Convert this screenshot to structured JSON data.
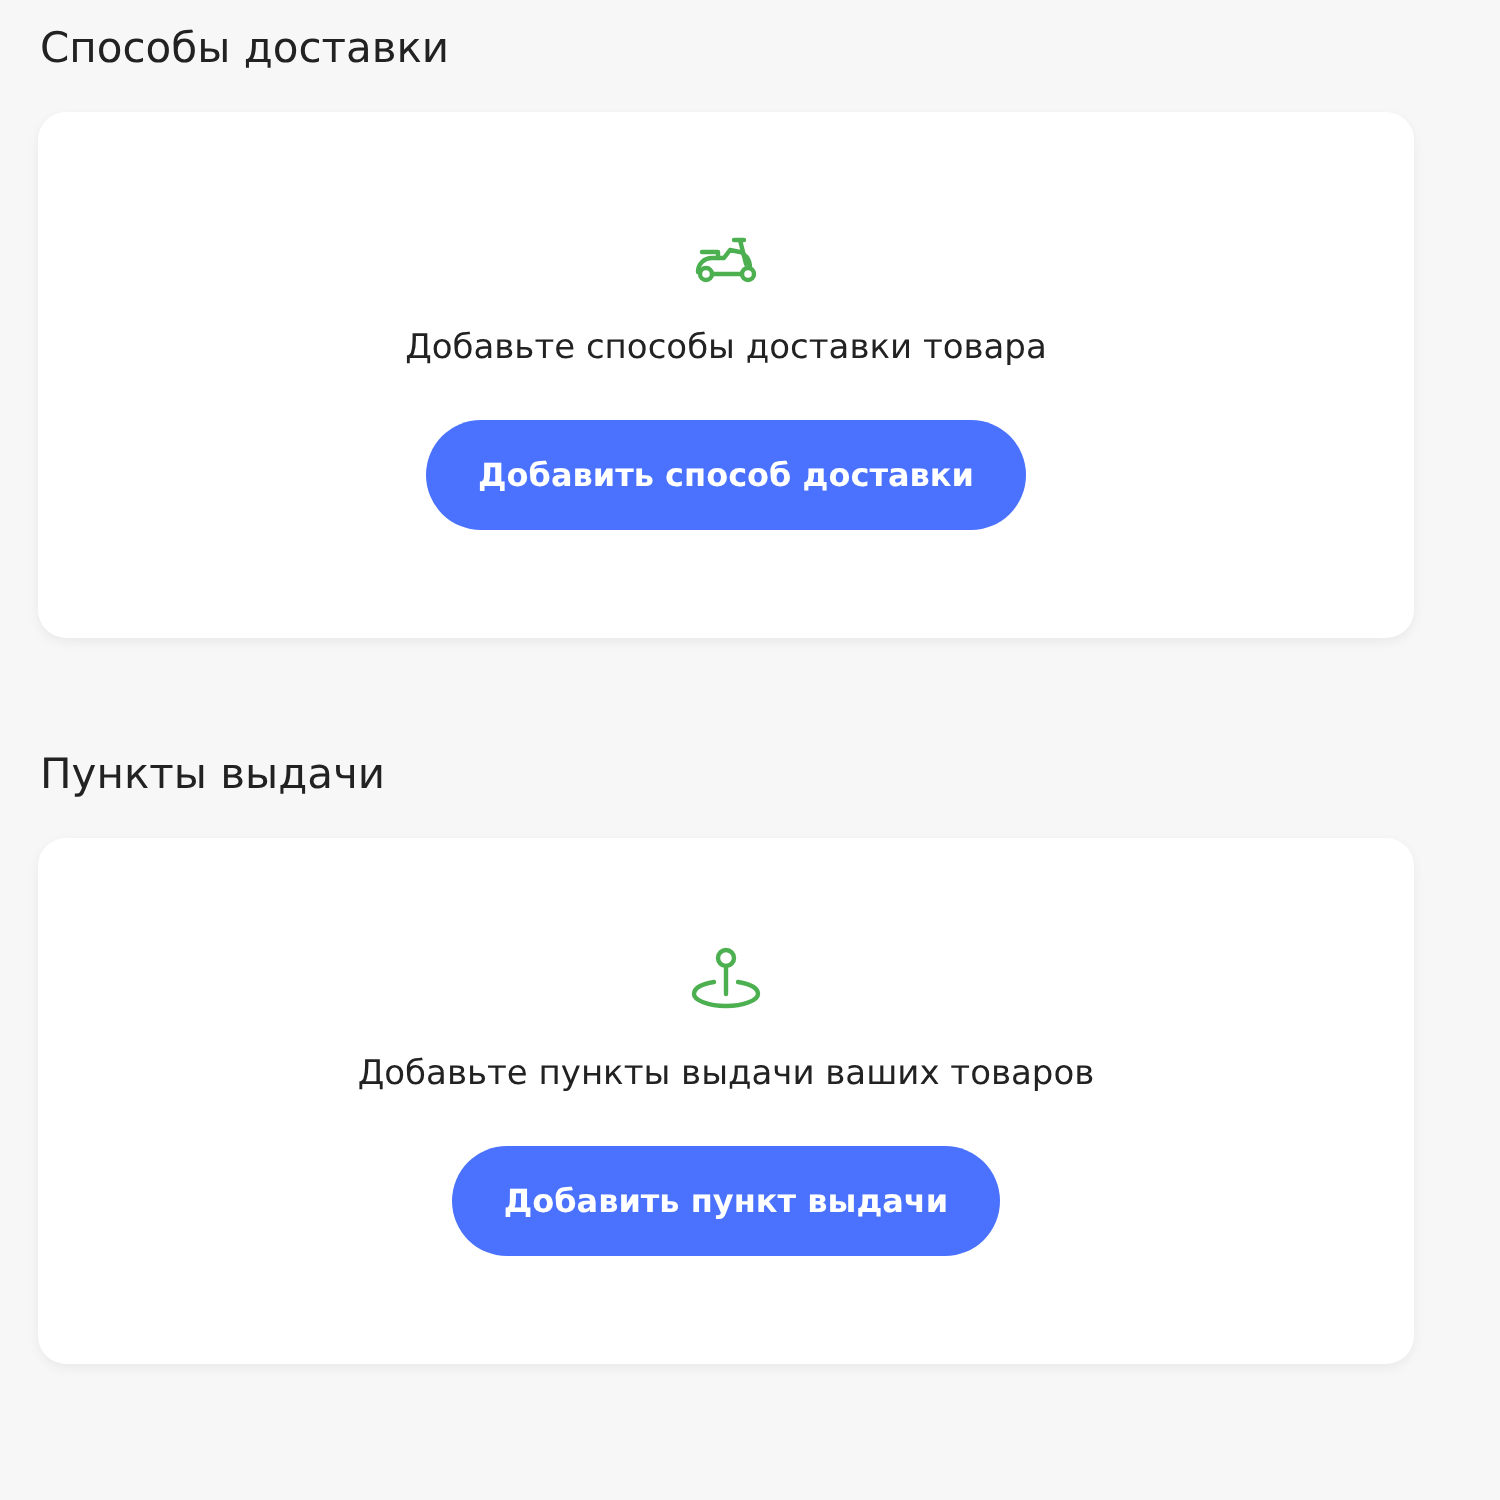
{
  "sections": [
    {
      "title": "Способы доставки",
      "kind": "delivery",
      "message": "Добавьте способы доставки товара",
      "button": "Добавить способ доставки"
    },
    {
      "title": "Пункты выдачи",
      "kind": "pickup",
      "message": "Добавьте пункты выдачи ваших товаров",
      "button": "Добавить пункт выдачи"
    }
  ]
}
